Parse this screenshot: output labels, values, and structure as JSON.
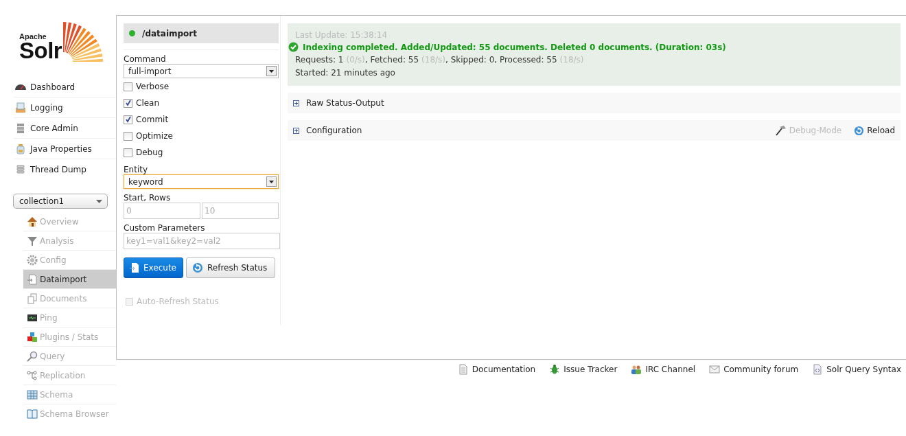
{
  "logo": {
    "vendor": "Apache",
    "product": "Solr"
  },
  "nav": [
    {
      "label": "Dashboard"
    },
    {
      "label": "Logging"
    },
    {
      "label": "Core Admin"
    },
    {
      "label": "Java Properties"
    },
    {
      "label": "Thread Dump"
    }
  ],
  "core_selector": {
    "value": "collection1"
  },
  "core_menu": [
    {
      "label": "Overview",
      "selected": false
    },
    {
      "label": "Analysis",
      "selected": false
    },
    {
      "label": "Config",
      "selected": false
    },
    {
      "label": "Dataimport",
      "selected": true
    },
    {
      "label": "Documents",
      "selected": false
    },
    {
      "label": "Ping",
      "selected": false
    },
    {
      "label": "Plugins / Stats",
      "selected": false
    },
    {
      "label": "Query",
      "selected": false
    },
    {
      "label": "Replication",
      "selected": false
    },
    {
      "label": "Schema",
      "selected": false
    },
    {
      "label": "Schema Browser",
      "selected": false
    }
  ],
  "handler": {
    "name": "/dataimport"
  },
  "form": {
    "command_label": "Command",
    "command": "full-import",
    "options": [
      {
        "label": "Verbose",
        "checked": false
      },
      {
        "label": "Clean",
        "checked": true
      },
      {
        "label": "Commit",
        "checked": true
      },
      {
        "label": "Optimize",
        "checked": false
      },
      {
        "label": "Debug",
        "checked": false
      }
    ],
    "entity_label": "Entity",
    "entity": "keyword",
    "entity_focused": true,
    "start_rows_label": "Start, Rows",
    "start_placeholder": "0",
    "rows_placeholder": "10",
    "custom_label": "Custom Parameters",
    "custom_placeholder": "key1=val1&key2=val2",
    "buttons": [
      {
        "label": "Execute",
        "kind": "primary"
      },
      {
        "label": "Refresh Status",
        "kind": "refresh"
      }
    ],
    "auto_refresh": {
      "label": "Auto-Refresh Status",
      "checked": false,
      "disabled": true
    }
  },
  "status": {
    "last_update": "Last Update: 15:38:14",
    "message": "Indexing completed. Added/Updated: 55 documents. Deleted 0 documents. (Duration: 03s)",
    "stats": [
      {
        "text": "Requests: 1",
        "rate": "(0/s)"
      },
      {
        "text": ", Fetched: 55",
        "rate": "(18/s)"
      },
      {
        "text": ", Skipped: 0, Processed: 55",
        "rate": "(18/s)"
      }
    ],
    "started": "Started: 21 minutes ago"
  },
  "sections": [
    {
      "label": "Raw Status-Output",
      "expanded": false
    },
    {
      "label": "Configuration",
      "expanded": false,
      "actions": [
        {
          "label": "Debug-Mode",
          "kind": "debug",
          "disabled": true
        },
        {
          "label": "Reload",
          "kind": "reload",
          "disabled": false
        }
      ]
    }
  ],
  "footer_links": [
    {
      "label": "Documentation"
    },
    {
      "label": "Issue Tracker"
    },
    {
      "label": "IRC Channel"
    },
    {
      "label": "Community forum"
    },
    {
      "label": "Solr Query Syntax"
    }
  ]
}
